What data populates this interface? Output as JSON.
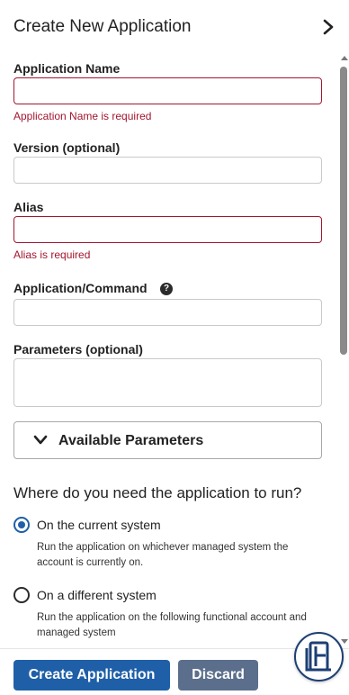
{
  "header": {
    "title": "Create New Application",
    "close_icon": "chevron-right-icon"
  },
  "form": {
    "app_name": {
      "label": "Application Name",
      "value": "",
      "error": "Application Name is required"
    },
    "version": {
      "label": "Version (optional)",
      "value": ""
    },
    "alias": {
      "label": "Alias",
      "value": "",
      "error": "Alias is required"
    },
    "command": {
      "label": "Application/Command",
      "value": "",
      "help_icon": "question-circle-icon",
      "help_glyph": "?"
    },
    "parameters": {
      "label": "Parameters (optional)",
      "value": ""
    },
    "available_parameters": {
      "label": "Available Parameters",
      "icon": "chevron-down-icon",
      "expanded": false
    }
  },
  "run_location": {
    "heading": "Where do you need the application to run?",
    "options": [
      {
        "label": "On the current system",
        "description": "Run the application on whichever managed system the account is currently on.",
        "selected": true
      },
      {
        "label": "On a different system",
        "description": "Run the application on the following functional account and managed system",
        "selected": false
      }
    ]
  },
  "footer": {
    "create_label": "Create Application",
    "discard_label": "Discard"
  },
  "colors": {
    "primary": "#1f5fa8",
    "secondary": "#5b6f8c",
    "error": "#a3162e",
    "brand": "#1d3f73"
  },
  "brand_badge": {
    "icon": "brand-logo-icon"
  }
}
